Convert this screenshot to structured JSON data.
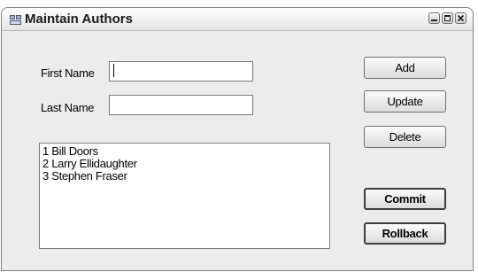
{
  "window": {
    "title": "Maintain Authors",
    "icon": "form-window-icon",
    "controls": [
      "minimize-icon",
      "maximize-icon",
      "close-icon"
    ]
  },
  "form": {
    "first_name_label": "First Name",
    "first_name_value": "",
    "last_name_label": "Last Name",
    "last_name_value": "",
    "authors": [
      "1 Bill Doors",
      "2 Larry Ellidaughter",
      "3 Stephen Fraser"
    ]
  },
  "buttons": {
    "add": "Add",
    "update": "Update",
    "delete": "Delete",
    "commit": "Commit",
    "rollback": "Rollback"
  }
}
